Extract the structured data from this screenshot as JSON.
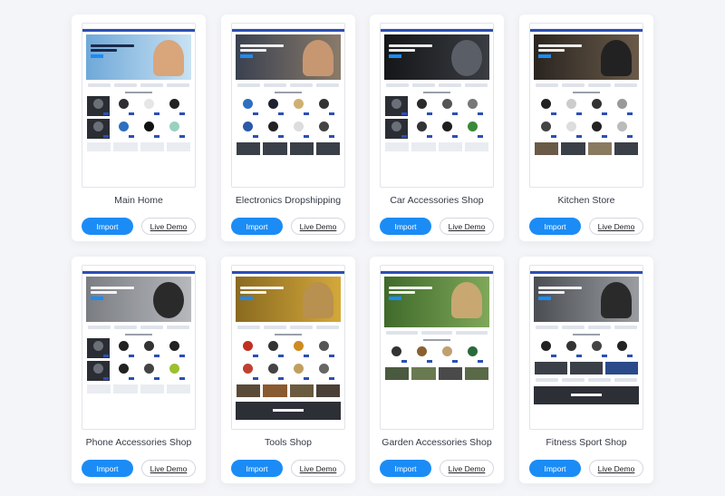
{
  "cards": [
    {
      "title": "Main Home",
      "import_label": "Import",
      "demo_label": "Live Demo"
    },
    {
      "title": "Electronics Dropshipping",
      "import_label": "Import",
      "demo_label": "Live Demo"
    },
    {
      "title": "Car Accessories Shop",
      "import_label": "Import",
      "demo_label": "Live Demo"
    },
    {
      "title": "Kitchen Store",
      "import_label": "Import",
      "demo_label": "Live Demo"
    },
    {
      "title": "Phone Accessories Shop",
      "import_label": "Import",
      "demo_label": "Live Demo"
    },
    {
      "title": "Tools Shop",
      "import_label": "Import",
      "demo_label": "Live Demo"
    },
    {
      "title": "Garden Accessories Shop",
      "import_label": "Import",
      "demo_label": "Live Demo"
    },
    {
      "title": "Fitness Sport Shop",
      "import_label": "Import",
      "demo_label": "Live Demo"
    }
  ],
  "colors": {
    "accent": "#1b8cf5",
    "nav_bar": "#2b4fb6",
    "page_background": "#f4f5f8"
  }
}
